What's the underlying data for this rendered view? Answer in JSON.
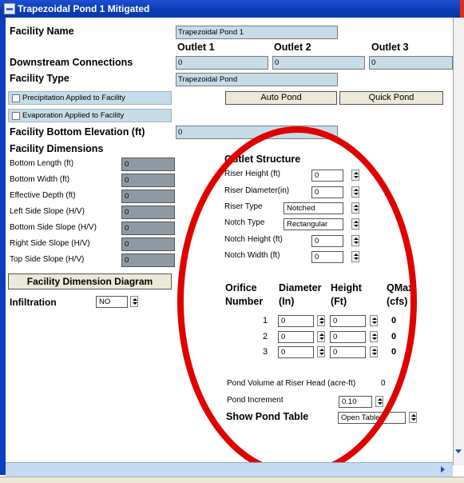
{
  "window": {
    "title": "Trapezoidal Pond  1 Mitigated"
  },
  "facility": {
    "name_label": "Facility Name",
    "name_value": "Trapezoidal Pond  1",
    "outlet_headers": [
      "Outlet 1",
      "Outlet 2",
      "Outlet 3"
    ],
    "downstream_label": "Downstream Connections",
    "downstream_values": [
      "0",
      "0",
      "0"
    ],
    "type_label": "Facility Type",
    "type_value": "Trapezoidal Pond",
    "precip_label": "Precipitation Applied to Facility",
    "evap_label": "Evaporation Applied to Facility",
    "auto_pond_button": "Auto Pond",
    "quick_pond_button": "Quick Pond",
    "bottom_elev_label": "Facility Bottom Elevation (ft)",
    "bottom_elev_value": "0"
  },
  "dimensions": {
    "heading": "Facility Dimensions",
    "fields": [
      {
        "label": "Bottom Length (ft)",
        "value": "0"
      },
      {
        "label": "Bottom Width (ft)",
        "value": "0"
      },
      {
        "label": "Effective Depth (ft)",
        "value": "0"
      },
      {
        "label": "Left Side Slope (H/V)",
        "value": "0"
      },
      {
        "label": "Bottom Side Slope (H/V)",
        "value": "0"
      },
      {
        "label": "Right Side Slope (H/V)",
        "value": "0"
      },
      {
        "label": "Top Side Slope (H/V)",
        "value": "0"
      }
    ],
    "diagram_button": "Facility Dimension Diagram",
    "infiltration_label": "Infiltration",
    "infiltration_value": "NO"
  },
  "outlet_structure": {
    "heading": "Outlet Structure",
    "riser_height_label": "Riser Height (ft)",
    "riser_height_value": "0",
    "riser_diameter_label": "Riser Diameter(in)",
    "riser_diameter_value": "0",
    "riser_type_label": "Riser Type",
    "riser_type_value": "Notched",
    "notch_type_label": "Notch Type",
    "notch_type_value": "Rectangular",
    "notch_height_label": "Notch Height (ft)",
    "notch_height_value": "0",
    "notch_width_label": "Notch Width (ft)",
    "notch_width_value": "0"
  },
  "orifice": {
    "col_number": [
      "Orifice",
      "Number"
    ],
    "col_diameter": [
      "Diameter",
      "(In)"
    ],
    "col_height": [
      "Height",
      "(Ft)"
    ],
    "col_qmax": [
      "QMax",
      "(cfs)"
    ],
    "rows": [
      {
        "number": "1",
        "diameter": "0",
        "height": "0",
        "qmax": "0"
      },
      {
        "number": "2",
        "diameter": "0",
        "height": "0",
        "qmax": "0"
      },
      {
        "number": "3",
        "diameter": "0",
        "height": "0",
        "qmax": "0"
      }
    ]
  },
  "pond": {
    "volume_label": "Pond Volume at Riser Head (acre-ft)",
    "volume_value": "0",
    "increment_label": "Pond Increment",
    "increment_value": "0.10",
    "show_table_label": "Show Pond Table",
    "show_table_value": "Open Table"
  },
  "colors": {
    "title_bar": "#0a3bb6",
    "field_blue": "#c6dce8",
    "field_gray": "#8d9aa4",
    "annotation_oval": "#e00000"
  }
}
